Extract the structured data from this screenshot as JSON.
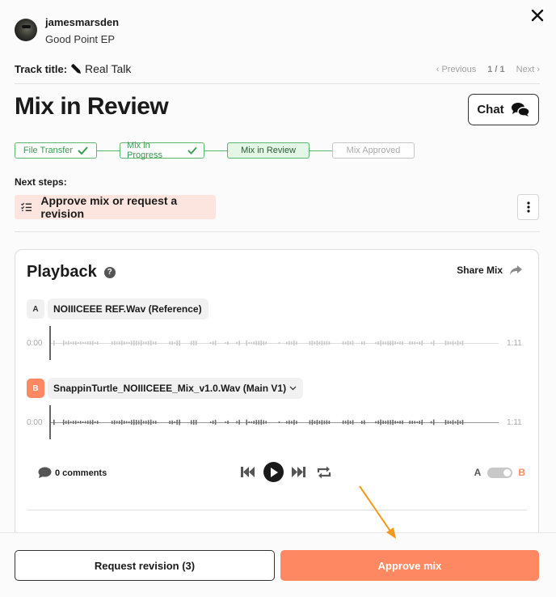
{
  "header": {
    "username": "jamesmarsden",
    "project": "Good Point EP",
    "avatar_icon": "user-avatar",
    "close_icon": "close-icon"
  },
  "track": {
    "label": "Track title:",
    "title": "Real Talk",
    "edit_icon": "pencil-icon"
  },
  "pager": {
    "previous": "‹ Previous",
    "count": "1 / 1",
    "next": "Next ›"
  },
  "page_title": "Mix in Review",
  "chat_button": {
    "label": "Chat",
    "icon": "chat-bubbles-icon"
  },
  "steps": [
    {
      "label": "File Transfer",
      "state": "done"
    },
    {
      "label": "Mix in Progress",
      "state": "done"
    },
    {
      "label": "Mix in Review",
      "state": "active"
    },
    {
      "label": "Mix Approved",
      "state": "pending"
    }
  ],
  "next_steps": {
    "label": "Next steps:",
    "task": "Approve mix or request a revision",
    "task_icon": "checklist-icon",
    "menu_icon": "kebab-icon"
  },
  "playback": {
    "title": "Playback",
    "help": "?",
    "share_label": "Share Mix",
    "tracks": [
      {
        "badge": "A",
        "file": "NOIIICEEE REF.Wav (Reference)",
        "start": "0:00",
        "end": "1:11",
        "active": false
      },
      {
        "badge": "B",
        "file": "SnappinTurtle_NOIIICEEE_Mix_v1.0.Wav (Main V1)",
        "start": "0:00",
        "end": "1:11",
        "active": true,
        "has_dropdown": true
      }
    ],
    "comments": "0 comments",
    "toggle": {
      "a": "A",
      "b": "B",
      "selected": "B"
    }
  },
  "footer": {
    "request_revision": "Request revision (3)",
    "approve": "Approve mix"
  },
  "colors": {
    "accent": "#fd8862",
    "step_green": "#5cb870",
    "next_step_bg": "#fde5df",
    "annotation_arrow": "#f39a1e"
  }
}
